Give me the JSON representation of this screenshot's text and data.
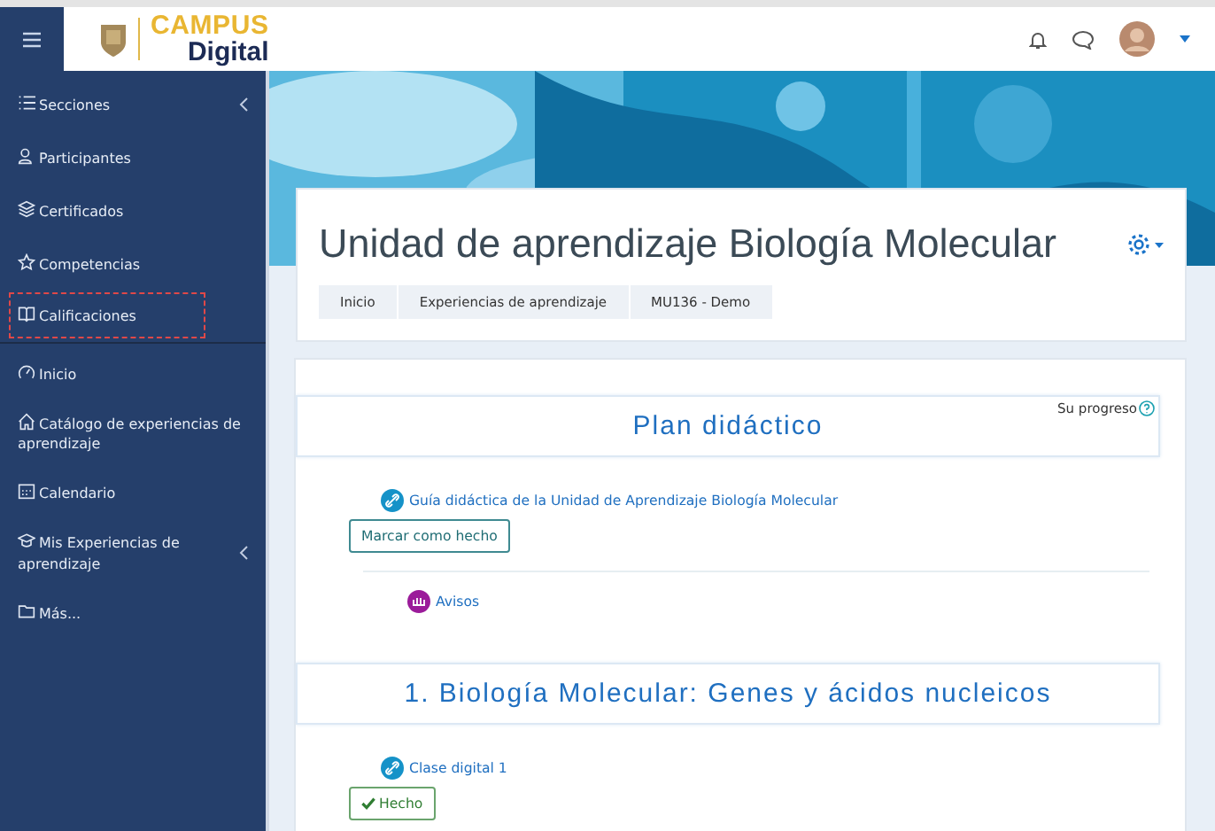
{
  "navbar": {
    "logo_top": "CAMPUS",
    "logo_bottom": "Digital"
  },
  "sidebar": {
    "items": [
      {
        "label": "Secciones",
        "expandable": true,
        "highlighted": false
      },
      {
        "label": "Participantes",
        "expandable": false,
        "highlighted": false
      },
      {
        "label": "Certificados",
        "expandable": false,
        "highlighted": false
      },
      {
        "label": "Competencias",
        "expandable": false,
        "highlighted": false
      },
      {
        "label": "Calificaciones",
        "expandable": false,
        "highlighted": true
      },
      {
        "label": "Inicio",
        "expandable": false,
        "highlighted": false
      },
      {
        "label": "Catálogo de experiencias de aprendizaje",
        "expandable": false,
        "highlighted": false
      },
      {
        "label": "Calendario",
        "expandable": false,
        "highlighted": false
      },
      {
        "label": "Mis Experiencias de aprendizaje",
        "expandable": true,
        "highlighted": false
      },
      {
        "label": "Más...",
        "expandable": false,
        "highlighted": false
      }
    ]
  },
  "header": {
    "title": "Unidad de aprendizaje Biología Molecular",
    "breadcrumb": [
      "Inicio",
      "Experiencias de aprendizaje",
      "MU136 - Demo"
    ]
  },
  "progress_label": "Su progreso",
  "sections": [
    {
      "title": "Plan didáctico",
      "activities": [
        {
          "kind": "link",
          "name": "Guía didáctica de la Unidad de Aprendizaje Biología Molecular",
          "completion": {
            "label": "Marcar como hecho",
            "done": false
          }
        },
        {
          "kind": "forum",
          "name": "Avisos"
        }
      ]
    },
    {
      "title": "1. Biología Molecular: Genes y ácidos nucleicos",
      "activities": [
        {
          "kind": "link",
          "name": "Clase digital 1",
          "completion": {
            "label": "Hecho",
            "done": true
          }
        }
      ]
    }
  ]
}
